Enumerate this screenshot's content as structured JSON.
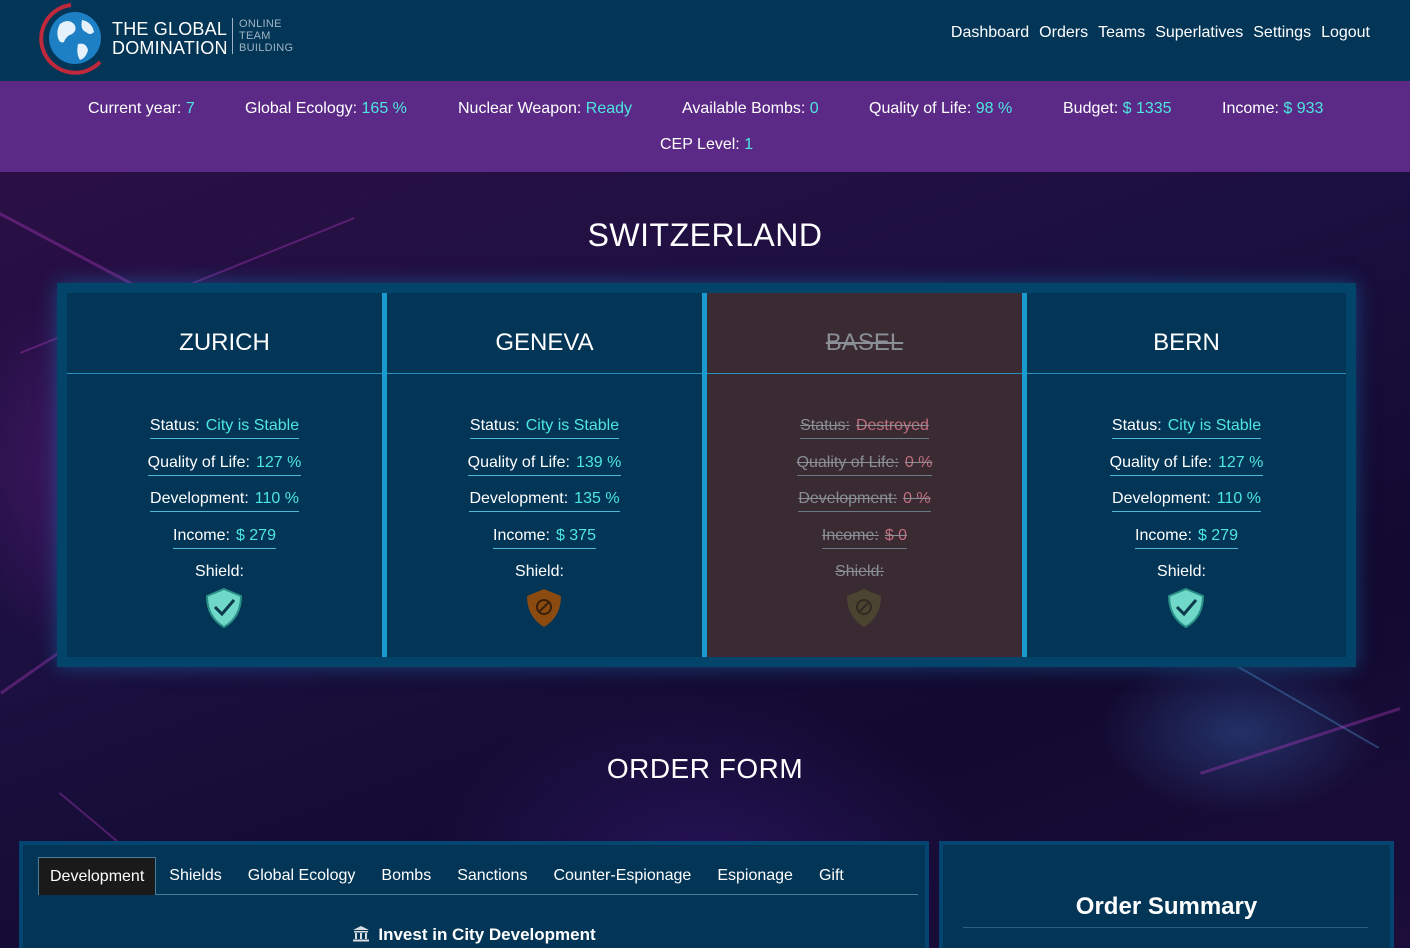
{
  "brand": {
    "title_line1": "THE GLOBAL",
    "title_line2": "DOMINATION",
    "sub_line1": "ONLINE",
    "sub_line2": "TEAM",
    "sub_line3": "BUILDING"
  },
  "nav": [
    "Dashboard",
    "Orders",
    "Teams",
    "Superlatives",
    "Settings",
    "Logout"
  ],
  "stats": {
    "year_label": "Current year:",
    "year": "7",
    "ecology_label": "Global Ecology:",
    "ecology": "165 %",
    "nuclear_label": "Nuclear Weapon:",
    "nuclear": "Ready",
    "bombs_label": "Available Bombs:",
    "bombs": "0",
    "qol_label": "Quality of Life:",
    "qol": "98 %",
    "budget_label": "Budget:",
    "budget": "$ 1335",
    "income_label": "Income:",
    "income": "$ 933",
    "cep_label": "CEP Level:",
    "cep": "1"
  },
  "country": "SWITZERLAND",
  "labels": {
    "status": "Status:",
    "qol": "Quality of Life:",
    "development": "Development:",
    "income": "Income:",
    "shield": "Shield:"
  },
  "cities": [
    {
      "name": "ZURICH",
      "status": "City is Stable",
      "qol": "127 %",
      "development": "110 %",
      "income": "$ 279",
      "shield": "shield-check-icon"
    },
    {
      "name": "GENEVA",
      "status": "City is Stable",
      "qol": "139 %",
      "development": "135 %",
      "income": "$ 375",
      "shield": "shield-blocked-icon"
    },
    {
      "name": "BASEL",
      "status": "Destroyed",
      "qol": "0 %",
      "development": "0 %",
      "income": "$ 0",
      "shield": "shield-blocked-icon"
    },
    {
      "name": "BERN",
      "status": "City is Stable",
      "qol": "127 %",
      "development": "110 %",
      "income": "$ 279",
      "shield": "shield-check-icon"
    }
  ],
  "order_form": {
    "title": "ORDER FORM",
    "tabs": [
      "Development",
      "Shields",
      "Global Ecology",
      "Bombs",
      "Sanctions",
      "Counter-Espionage",
      "Espionage",
      "Gift"
    ],
    "active_tab": "Development",
    "section_title": "Invest in City Development"
  },
  "order_summary": {
    "title": "Order Summary"
  },
  "colors": {
    "accent_value": "#4de6e0",
    "header_bg": "#033556",
    "stats_bg": "#5b2a86",
    "destroyed_bg": "#3a2a32",
    "shield_ok": "#6fd8c8",
    "shield_blocked": "#8a4a10"
  }
}
